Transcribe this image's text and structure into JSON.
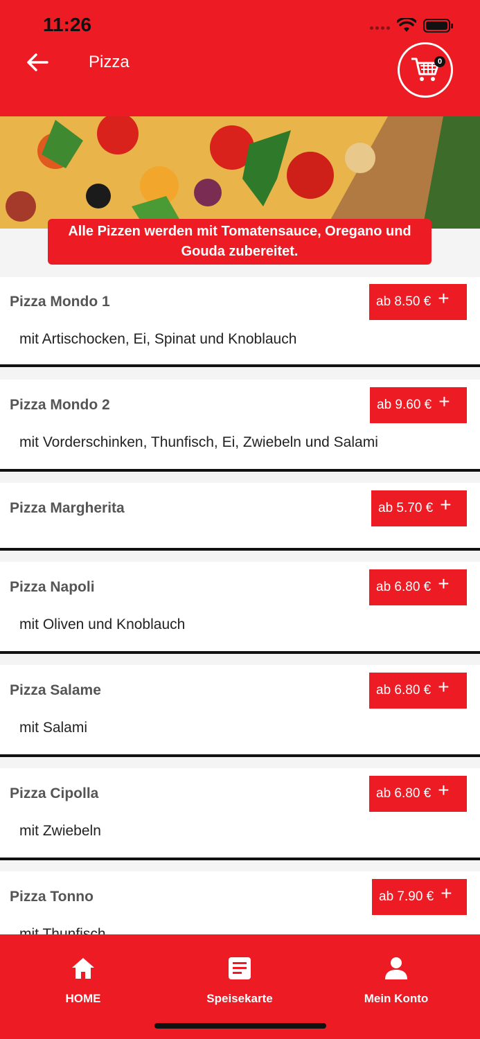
{
  "status_bar": {
    "time": "11:26"
  },
  "header": {
    "title": "Pizza",
    "cart_count": "0"
  },
  "notice": "Alle Pizzen werden mit Tomatensauce, Oregano und Gouda zubereitet.",
  "items": [
    {
      "name": "Pizza Mondo 1",
      "price": "ab 8.50 €",
      "desc": "mit Artischocken, Ei, Spinat und Knoblauch"
    },
    {
      "name": "Pizza Mondo 2",
      "price": "ab 9.60 €",
      "desc": "mit Vorderschinken, Thunfisch, Ei, Zwiebeln und Salami"
    },
    {
      "name": "Pizza Margherita",
      "price": "ab 5.70 €",
      "desc": ""
    },
    {
      "name": "Pizza Napoli",
      "price": "ab 6.80 €",
      "desc": "mit Oliven und Knoblauch"
    },
    {
      "name": "Pizza Salame",
      "price": "ab 6.80 €",
      "desc": "mit Salami"
    },
    {
      "name": "Pizza Cipolla",
      "price": "ab 6.80 €",
      "desc": "mit Zwiebeln"
    },
    {
      "name": "Pizza Tonno",
      "price": "ab 7.90 €",
      "desc": "mit Thunfisch"
    }
  ],
  "add_symbol": "+",
  "nav": {
    "home": "HOME",
    "menu": "Speisekarte",
    "account": "Mein Konto"
  },
  "colors": {
    "brand_red": "#ec1b24"
  },
  "icons": {
    "back": "arrow-left-icon",
    "cart": "shopping-cart-icon",
    "home": "home-icon",
    "menu": "document-icon",
    "account": "user-icon"
  }
}
